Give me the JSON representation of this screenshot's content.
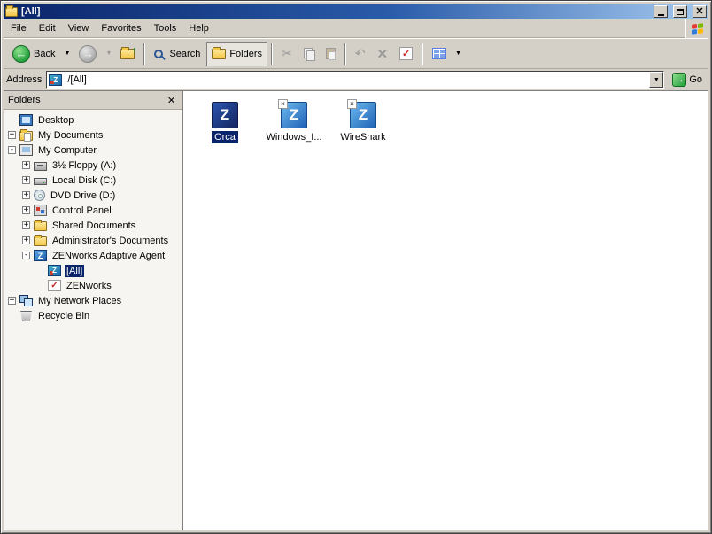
{
  "window": {
    "title": "[All]"
  },
  "menu": {
    "items": [
      "File",
      "Edit",
      "View",
      "Favorites",
      "Tools",
      "Help"
    ]
  },
  "toolbar": {
    "back_label": "Back",
    "search_label": "Search",
    "folders_label": "Folders"
  },
  "address": {
    "label": "Address",
    "value": "/[All]",
    "go_label": "Go"
  },
  "folders_pane": {
    "title": "Folders"
  },
  "tree": [
    {
      "label": "Desktop",
      "level": 0,
      "expander": null,
      "icon": "desktop-icon",
      "selected": false
    },
    {
      "label": "My Documents",
      "level": 0,
      "expander": "+",
      "icon": "my-documents-icon",
      "selected": false
    },
    {
      "label": "My Computer",
      "level": 0,
      "expander": "-",
      "icon": "my-computer-icon",
      "selected": false
    },
    {
      "label": "3½ Floppy (A:)",
      "level": 1,
      "expander": "+",
      "icon": "floppy-drive-icon",
      "selected": false
    },
    {
      "label": "Local Disk (C:)",
      "level": 1,
      "expander": "+",
      "icon": "local-disk-icon",
      "selected": false
    },
    {
      "label": "DVD Drive (D:)",
      "level": 1,
      "expander": "+",
      "icon": "dvd-drive-icon",
      "selected": false
    },
    {
      "label": "Control Panel",
      "level": 1,
      "expander": "+",
      "icon": "control-panel-icon",
      "selected": false
    },
    {
      "label": "Shared Documents",
      "level": 1,
      "expander": "+",
      "icon": "folder-icon",
      "selected": false
    },
    {
      "label": "Administrator's Documents",
      "level": 1,
      "expander": "+",
      "icon": "folder-icon",
      "selected": false
    },
    {
      "label": "ZENworks Adaptive Agent",
      "level": 1,
      "expander": "-",
      "icon": "zenworks-agent-icon",
      "selected": false
    },
    {
      "label": "[All]",
      "level": 2,
      "expander": null,
      "icon": "zen-folder-icon",
      "selected": true
    },
    {
      "label": "ZENworks",
      "level": 2,
      "expander": null,
      "icon": "zen-check-icon",
      "selected": false
    },
    {
      "label": "My Network Places",
      "level": 0,
      "expander": "+",
      "icon": "network-places-icon",
      "selected": false
    },
    {
      "label": "Recycle Bin",
      "level": 0,
      "expander": null,
      "icon": "recycle-bin-icon",
      "selected": false
    }
  ],
  "content": {
    "items": [
      {
        "label": "Orca",
        "icon": "orca-app-icon",
        "selected": true,
        "overlay": false,
        "variant": "doc"
      },
      {
        "label": "Windows_I...",
        "icon": "zenworks-app-icon",
        "selected": false,
        "overlay": true,
        "variant": "app"
      },
      {
        "label": "WireShark",
        "icon": "zenworks-app-icon",
        "selected": false,
        "overlay": true,
        "variant": "app"
      }
    ]
  },
  "colors": {
    "titlebar_start": "#0a246a",
    "titlebar_end": "#a6caf0",
    "chrome": "#d4d0c8",
    "selection": "#0a246a",
    "app_icon_blue": "#1e62b5"
  }
}
